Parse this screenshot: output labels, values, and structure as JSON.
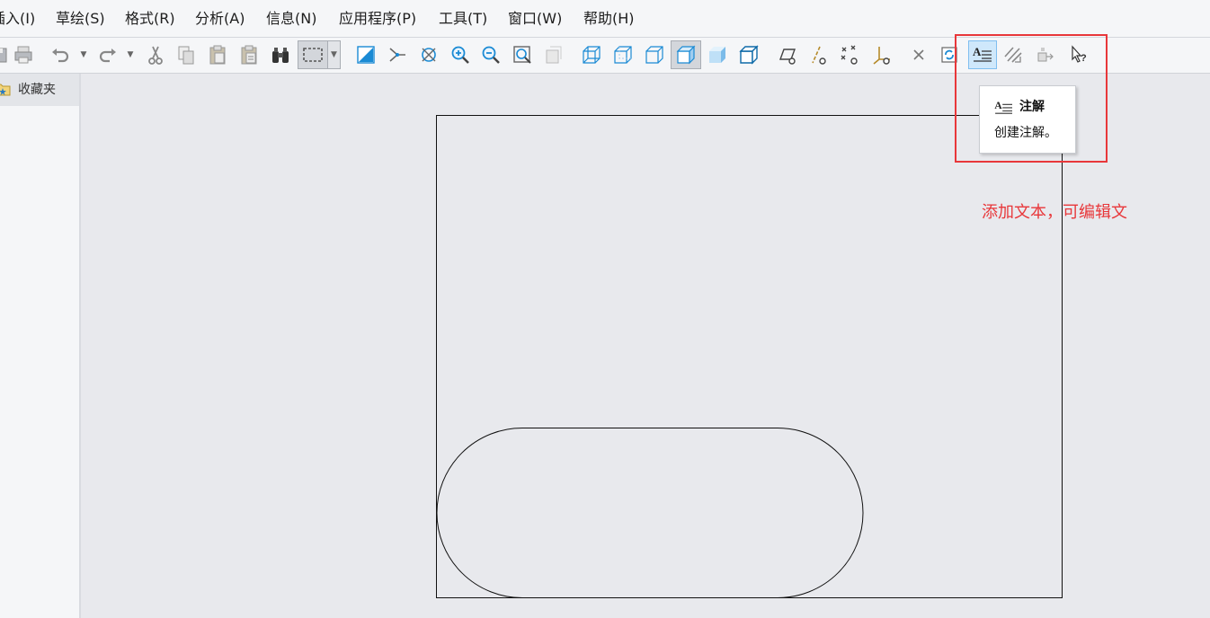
{
  "menu": {
    "items": [
      {
        "label": "插入(I)"
      },
      {
        "label": "草绘(S)"
      },
      {
        "label": "格式(R)"
      },
      {
        "label": "分析(A)"
      },
      {
        "label": "信息(N)"
      },
      {
        "label": "应用程序(P)"
      },
      {
        "label": "工具(T)"
      },
      {
        "label": "窗口(W)"
      },
      {
        "label": "帮助(H)"
      }
    ]
  },
  "toolbar": {
    "icons": [
      "save-icon",
      "print-icon",
      "undo-icon",
      "redo-icon",
      "cut-icon",
      "copy-icon",
      "paste-icon",
      "paste-special-icon",
      "find-icon",
      "select-box-icon",
      "repaint-icon",
      "spin-center-icon",
      "orient-icon",
      "zoom-in-icon",
      "zoom-out-icon",
      "refit-icon",
      "shade-icon",
      "wireframe-icon",
      "hidden-line-icon",
      "no-hidden-icon",
      "shading-icon",
      "shading-edges-icon",
      "plane-display-icon",
      "axis-display-icon",
      "point-display-icon",
      "csys-display-icon",
      "delete-icon",
      "regenerate-icon",
      "note-icon",
      "hatch-icon",
      "snap-icon",
      "help-whats-this-icon"
    ],
    "pressed_icon": "no-hidden-icon",
    "hovered_icon": "note-icon"
  },
  "sidebar": {
    "favorites_label": "收藏夹"
  },
  "tooltip": {
    "title": "注解",
    "description": "创建注解。"
  },
  "annotation": {
    "text": "添加文本，可编辑文",
    "color": "#e8373a"
  },
  "colors": {
    "accent_blue": "#1a8ad4",
    "highlight_red": "#e8373a",
    "canvas_bg": "#e8e9ed"
  }
}
